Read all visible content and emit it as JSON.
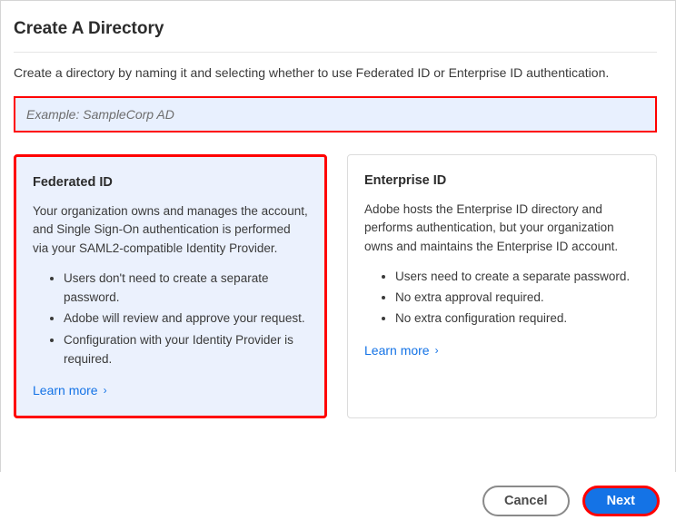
{
  "header": {
    "title": "Create A Directory",
    "subtitle": "Create a directory by naming it and selecting whether to use Federated ID or Enterprise ID authentication."
  },
  "input": {
    "placeholder": "Example: SampleCorp AD",
    "value": ""
  },
  "cards": {
    "federated": {
      "title": "Federated ID",
      "desc": "Your organization owns and manages the account, and Single Sign-On authentication is performed via your SAML2-compatible Identity Provider.",
      "bullets": [
        "Users don't need to create a separate password.",
        "Adobe will review and approve your request.",
        "Configuration with your Identity Provider is required."
      ],
      "learn_more": "Learn more"
    },
    "enterprise": {
      "title": "Enterprise ID",
      "desc": "Adobe hosts the Enterprise ID directory and performs authentication, but your organization owns and maintains the Enterprise ID account.",
      "bullets": [
        "Users need to create a separate password.",
        "No extra approval required.",
        "No extra configuration required."
      ],
      "learn_more": "Learn more"
    }
  },
  "footer": {
    "cancel": "Cancel",
    "next": "Next"
  }
}
